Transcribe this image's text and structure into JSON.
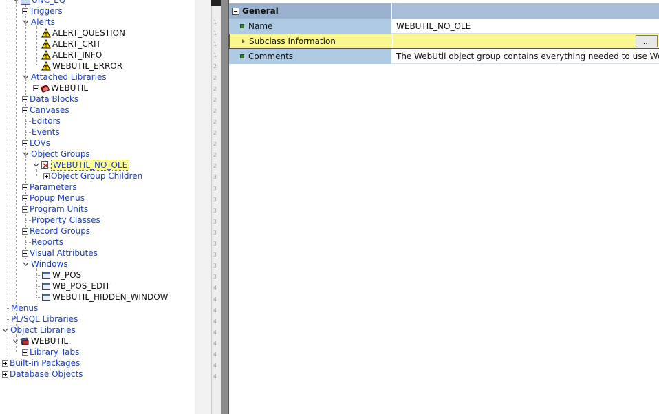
{
  "tree": {
    "root_truncated": "UNC_EQ",
    "items": [
      {
        "id": "triggers",
        "label": "Triggers"
      },
      {
        "id": "alerts",
        "label": "Alerts"
      },
      {
        "id": "alert_question",
        "label": "ALERT_QUESTION"
      },
      {
        "id": "alert_crit",
        "label": "ALERT_CRIT"
      },
      {
        "id": "alert_info",
        "label": "ALERT_INFO"
      },
      {
        "id": "webutil_error",
        "label": "WEBUTIL_ERROR"
      },
      {
        "id": "attached_libraries",
        "label": "Attached Libraries"
      },
      {
        "id": "webutil_lib",
        "label": "WEBUTIL"
      },
      {
        "id": "data_blocks",
        "label": "Data Blocks"
      },
      {
        "id": "canvases",
        "label": "Canvases"
      },
      {
        "id": "editors",
        "label": "Editors"
      },
      {
        "id": "events",
        "label": "Events"
      },
      {
        "id": "lovs",
        "label": "LOVs"
      },
      {
        "id": "object_groups",
        "label": "Object Groups"
      },
      {
        "id": "webutil_no_ole",
        "label": "WEBUTIL_NO_OLE"
      },
      {
        "id": "object_group_children",
        "label": "Object Group Children"
      },
      {
        "id": "parameters",
        "label": "Parameters"
      },
      {
        "id": "popup_menus",
        "label": "Popup Menus"
      },
      {
        "id": "program_units",
        "label": "Program Units"
      },
      {
        "id": "property_classes",
        "label": "Property Classes"
      },
      {
        "id": "record_groups",
        "label": "Record Groups"
      },
      {
        "id": "reports",
        "label": "Reports"
      },
      {
        "id": "visual_attributes",
        "label": "Visual Attributes"
      },
      {
        "id": "windows",
        "label": "Windows"
      },
      {
        "id": "w_pos",
        "label": "W_POS"
      },
      {
        "id": "wb_pos_edit",
        "label": "WB_POS_EDIT"
      },
      {
        "id": "webutil_hidden_window",
        "label": "WEBUTIL_HIDDEN_WINDOW"
      },
      {
        "id": "menus",
        "label": "Menus"
      },
      {
        "id": "plsql_libraries",
        "label": "PL/SQL Libraries"
      },
      {
        "id": "object_libraries",
        "label": "Object Libraries"
      },
      {
        "id": "webutil_objlib",
        "label": "WEBUTIL"
      },
      {
        "id": "library_tabs",
        "label": "Library Tabs"
      },
      {
        "id": "builtin_packages",
        "label": "Built-in Packages"
      },
      {
        "id": "database_objects",
        "label": "Database Objects"
      }
    ]
  },
  "gutter": {
    "ticks": [
      "1",
      "1",
      "1",
      "1",
      "2",
      "2",
      "2",
      "2",
      "2",
      "2",
      "2",
      "2",
      "2",
      "2",
      "3",
      "3",
      "3",
      "3",
      "3",
      "3",
      "3",
      "3",
      "3",
      "3",
      "4",
      "4",
      "4",
      "4",
      "4",
      "4",
      "4",
      "4",
      "4"
    ]
  },
  "palette": {
    "section": "General",
    "rows": [
      {
        "name": "Name",
        "value": "WEBUTIL_NO_OLE"
      },
      {
        "name": "Subclass Information",
        "value": "",
        "button": "..."
      },
      {
        "name": "Comments",
        "value": "The WebUtil object group contains everything needed to use WebUtil in"
      }
    ]
  },
  "colors": {
    "tree_text": "#1a3fc8",
    "selection": "#ffff99",
    "section_header": "#9ab2cf",
    "property_name_bg": "#aecbe3",
    "highlight_row": "#fbf78f"
  }
}
